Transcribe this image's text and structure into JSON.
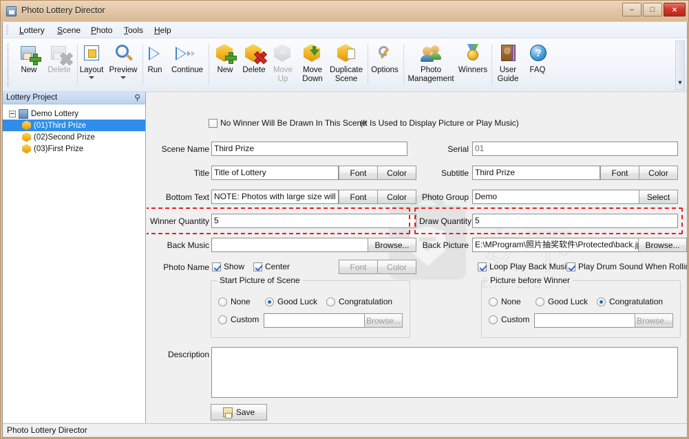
{
  "window": {
    "title": "Photo Lottery Director",
    "icon": "app-icon",
    "controls": {
      "minimize": "–",
      "maximize": "□",
      "close": "×"
    }
  },
  "menubar": {
    "items": [
      {
        "label": "Lottery",
        "accel": "L"
      },
      {
        "label": "Scene",
        "accel": "S"
      },
      {
        "label": "Photo",
        "accel": "P"
      },
      {
        "label": "Tools",
        "accel": "T"
      },
      {
        "label": "Help",
        "accel": "H"
      }
    ]
  },
  "toolbar": {
    "overflow_glyph": "▼",
    "buttons": [
      {
        "label": "New",
        "icon": "new-lottery-icon",
        "disabled": false,
        "caret": false
      },
      {
        "label": "Delete",
        "icon": "delete-lottery-icon",
        "disabled": true,
        "caret": false
      },
      {
        "label": "Layout",
        "icon": "layout-icon",
        "disabled": false,
        "caret": true
      },
      {
        "label": "Preview",
        "icon": "preview-icon",
        "disabled": false,
        "caret": true
      },
      {
        "label": "Run",
        "icon": "run-icon",
        "disabled": false,
        "caret": false
      },
      {
        "label": "Continue",
        "icon": "continue-icon",
        "disabled": false,
        "caret": false
      },
      {
        "label": "New",
        "icon": "new-scene-icon",
        "disabled": false,
        "caret": false
      },
      {
        "label": "Delete",
        "icon": "delete-scene-icon",
        "disabled": false,
        "caret": false
      },
      {
        "label": "Move\nUp",
        "icon": "move-up-icon",
        "disabled": true,
        "caret": false
      },
      {
        "label": "Move\nDown",
        "icon": "move-down-icon",
        "disabled": false,
        "caret": false
      },
      {
        "label": "Duplicate\nScene",
        "icon": "duplicate-scene-icon",
        "disabled": false,
        "caret": false
      },
      {
        "label": "Options",
        "icon": "options-icon",
        "disabled": false,
        "caret": false
      },
      {
        "label": "Photo\nManagement",
        "icon": "photo-management-icon",
        "disabled": false,
        "caret": false
      },
      {
        "label": "Winners",
        "icon": "winners-icon",
        "disabled": false,
        "caret": false
      },
      {
        "label": "User\nGuide",
        "icon": "user-guide-icon",
        "disabled": false,
        "caret": false
      },
      {
        "label": "FAQ",
        "icon": "faq-icon",
        "disabled": false,
        "caret": false
      }
    ]
  },
  "sidebar": {
    "title": "Lottery Project",
    "pin_icon": "pin-icon",
    "tree": [
      {
        "label": "Demo Lottery",
        "level": 1,
        "icon": "lottery-icon",
        "selected": false,
        "expander": "minus"
      },
      {
        "label": "(01)Third Prize",
        "level": 2,
        "icon": "scene-icon",
        "selected": true
      },
      {
        "label": "(02)Second Prize",
        "level": 2,
        "icon": "scene-icon",
        "selected": false
      },
      {
        "label": "(03)First Prize",
        "level": 2,
        "icon": "scene-icon",
        "selected": false
      }
    ]
  },
  "watermark": {
    "cn_text": "安下",
    "url_text": "anxz.com"
  },
  "form": {
    "no_winner_checkbox": {
      "label": "No Winner Will Be Drawn In This Scene",
      "hint": "(It Is Used to Display Picture or Play Music)",
      "checked": false
    },
    "scene_name": {
      "label": "Scene Name",
      "value": "Third Prize"
    },
    "serial": {
      "label": "Serial",
      "value": "01"
    },
    "title": {
      "label": "Title",
      "value": "Title of Lottery",
      "font_button": "Font",
      "color_button": "Color"
    },
    "subtitle": {
      "label": "Subtitle",
      "value": "Third Prize",
      "font_button": "Font",
      "color_button": "Color"
    },
    "bottom_text": {
      "label": "Bottom Text",
      "value": "NOTE: Photos with large size will m",
      "font_button": "Font",
      "color_button": "Color"
    },
    "photo_group": {
      "label": "Photo Group",
      "value": "Demo",
      "select_button": "Select"
    },
    "winner_quantity": {
      "label": "Winner Quantity",
      "value": "5",
      "highlight_color": "#e02020"
    },
    "draw_quantity": {
      "label": "Draw Quantity",
      "value": "5",
      "highlight_color": "#e02020"
    },
    "back_music": {
      "label": "Back Music",
      "value": "",
      "browse_button": "Browse..."
    },
    "back_picture": {
      "label": "Back Picture",
      "value": "E:\\MProgram\\照片抽奖软件\\Protected\\back.jp",
      "browse_button": "Browse..."
    },
    "photo_name": {
      "label": "Photo Name",
      "show": {
        "label": "Show",
        "checked": true
      },
      "center": {
        "label": "Center",
        "checked": true
      },
      "font_button": "Font",
      "color_button": "Color"
    },
    "loop_play_back_music": {
      "label": "Loop Play Back Music",
      "checked": true
    },
    "play_drum_sound": {
      "label": "Play Drum Sound When Rolling P",
      "checked": true
    },
    "start_picture_group": {
      "title": "Start Picture of Scene",
      "options": [
        {
          "label": "None",
          "selected": false
        },
        {
          "label": "Good Luck",
          "selected": true
        },
        {
          "label": "Congratulation",
          "selected": false
        },
        {
          "label": "Custom",
          "selected": false
        }
      ],
      "custom_value": "",
      "browse_button": "Browse..."
    },
    "winner_picture_group": {
      "title": "Picture before Winner",
      "options": [
        {
          "label": "None",
          "selected": false
        },
        {
          "label": "Good Luck",
          "selected": false
        },
        {
          "label": "Congratulation",
          "selected": true
        },
        {
          "label": "Custom",
          "selected": false
        }
      ],
      "custom_value": "",
      "browse_button": "Browse..."
    },
    "description": {
      "label": "Description",
      "value": ""
    },
    "save_button": {
      "label": "Save",
      "icon": "save-icon"
    }
  },
  "statusbar": {
    "text": "Photo Lottery Director"
  }
}
